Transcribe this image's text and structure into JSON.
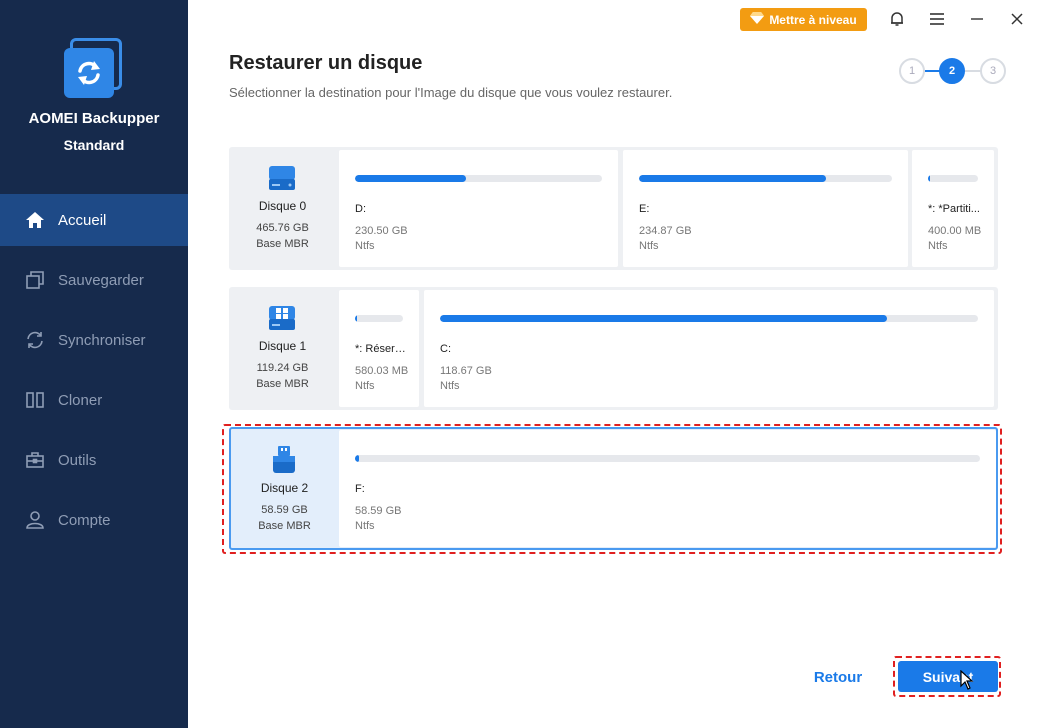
{
  "app": {
    "name": "AOMEI Backupper",
    "edition": "Standard"
  },
  "topbar": {
    "upgrade_label": "Mettre à niveau"
  },
  "nav": [
    {
      "label": "Accueil",
      "icon": "home-icon",
      "active": true
    },
    {
      "label": "Sauvegarder",
      "icon": "backup-icon",
      "active": false
    },
    {
      "label": "Synchroniser",
      "icon": "sync-icon",
      "active": false
    },
    {
      "label": "Cloner",
      "icon": "clone-icon",
      "active": false
    },
    {
      "label": "Outils",
      "icon": "tools-icon",
      "active": false
    },
    {
      "label": "Compte",
      "icon": "user-icon",
      "active": false
    }
  ],
  "header": {
    "title": "Restaurer un disque",
    "subtitle": "Sélectionner la destination pour l'Image du disque que vous voulez restaurer."
  },
  "steps": [
    "1",
    "2",
    "3"
  ],
  "current_step": 2,
  "disks": [
    {
      "name": "Disque 0",
      "size": "465.76 GB",
      "type": "Base MBR",
      "icon": "hard-disk-icon",
      "partitions": [
        {
          "name": "D:",
          "size": "230.50 GB",
          "fs": "Ntfs",
          "used": 0.45
        },
        {
          "name": "E:",
          "size": "234.87 GB",
          "fs": "Ntfs",
          "used": 0.74
        },
        {
          "name": "*: *Partiti...",
          "size": "400.00 MB",
          "fs": "Ntfs",
          "used": 0.04
        }
      ]
    },
    {
      "name": "Disque 1",
      "size": "119.24 GB",
      "type": "Base MBR",
      "icon": "windows-disk-icon",
      "partitions": [
        {
          "name": "*: Réservé...",
          "size": "580.03 MB",
          "fs": "Ntfs",
          "used": 0.05
        },
        {
          "name": "C:",
          "size": "118.67 GB",
          "fs": "Ntfs",
          "used": 0.83
        }
      ]
    },
    {
      "name": "Disque 2",
      "size": "58.59 GB",
      "type": "Base MBR",
      "icon": "usb-drive-icon",
      "selected": true,
      "partitions": [
        {
          "name": "F:",
          "size": "58.59 GB",
          "fs": "Ntfs",
          "used": 0.006
        }
      ]
    }
  ],
  "footer": {
    "back_label": "Retour",
    "next_label": "Suivant"
  },
  "colors": {
    "accent": "#1a7ae8",
    "sidebar": "#162a4c",
    "sidebar_active": "#1e4a87",
    "upgrade": "#f39c12",
    "highlight": "#e02020"
  }
}
